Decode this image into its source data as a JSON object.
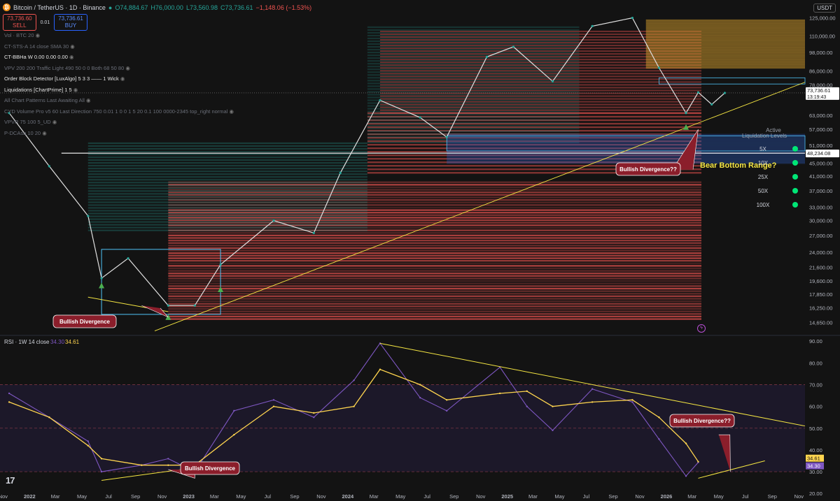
{
  "header": {
    "symbol": "Bitcoin / TetherUS · 1D · Binance",
    "open": "O74,884.67",
    "high": "H76,000.00",
    "low": "L73,560.98",
    "close": "C73,736.61",
    "change": "−1,148.06 (−1.53%)"
  },
  "trade": {
    "sell_price": "73,736.60",
    "sell_label": "SELL",
    "qty": "0.01",
    "buy_price": "73,736.61",
    "buy_label": "BUY"
  },
  "currency": "USDT",
  "indicators": [
    {
      "text": "Vol · BTC 20",
      "bright": false
    },
    {
      "text": "CT-STS-A 14 close SMA 30",
      "bright": false
    },
    {
      "text": "CT-BBHa W 0.00 0.00 0.00",
      "bright": true
    },
    {
      "text": "VPV 200 200 Traffic Light 490 50 0 0 Both 68 50 80",
      "bright": false
    },
    {
      "text": "Order Block Detector [LuxAlgo] 5 3 3 —— 1 Wick",
      "bright": true
    },
    {
      "text": "Liquidations [ChartPrime] 1 5",
      "bright": true
    },
    {
      "text": "All Chart Patterns Last Awaiting All",
      "bright": false
    },
    {
      "text": "CYD Volume Pro v5 60 Last Direction 750 0.01 1 0 0 1 5 20 0.1 100 0000-2345 top_right normal",
      "bright": false
    },
    {
      "text": "VPVR 75 100 5_UD",
      "bright": false
    },
    {
      "text": "P-DCAsa 10 20",
      "bright": false
    }
  ],
  "chart_data": [
    {
      "type": "line",
      "title": "Bitcoin / TetherUS · 1D · Binance",
      "yscale": "log",
      "ylim": [
        13500,
        135000
      ],
      "y_ticks": [
        "125,000.00",
        "110,000.00",
        "98,000.00",
        "86,000.00",
        "78,000.00",
        "63,000.00",
        "57,000.00",
        "51,000.00",
        "45,000.00",
        "41,000.00",
        "37,000.00",
        "33,000.00",
        "30,000.00",
        "27,000.00",
        "24,000.00",
        "21,600.00",
        "19,600.00",
        "17,850.00",
        "16,250.00",
        "14,650.00"
      ],
      "x_ticks": [
        "Nov",
        "2022",
        "Mar",
        "May",
        "Jul",
        "Sep",
        "Nov",
        "2023",
        "Mar",
        "May",
        "Jul",
        "Sep",
        "Nov",
        "2024",
        "Mar",
        "May",
        "Jul",
        "Sep",
        "Nov",
        "2025",
        "Mar",
        "May",
        "Jul",
        "Sep",
        "Nov",
        "2026",
        "Mar",
        "May",
        "Jul",
        "Sep",
        "Nov"
      ],
      "x": [
        "2021-11",
        "2022-02",
        "2022-05",
        "2022-06",
        "2022-08",
        "2022-11",
        "2023-01",
        "2023-03",
        "2023-07",
        "2023-10",
        "2023-12",
        "2024-03",
        "2024-06",
        "2024-08",
        "2024-11",
        "2025-01",
        "2025-04",
        "2025-07",
        "2025-10",
        "2025-12",
        "2026-02",
        "2026-03",
        "2026-04",
        "2026-05"
      ],
      "series": [
        {
          "values": [
            64000,
            44000,
            31000,
            20000,
            23000,
            16500,
            16500,
            22000,
            30000,
            27500,
            42000,
            70000,
            62000,
            54000,
            95000,
            102000,
            80000,
            118000,
            125000,
            88000,
            64000,
            74000,
            68000,
            73700
          ]
        }
      ],
      "price_labels": {
        "current": "73,736.61",
        "countdown": "13:19:43",
        "marked": "48,234.08"
      },
      "annotations": [
        {
          "text": "Bullish Divergence",
          "x": "2022-10"
        },
        {
          "text": "Bullish Divergence??",
          "x": "2026-02"
        },
        {
          "text": "Bear Bottom Range?",
          "x": "2026-05"
        }
      ],
      "liquidation_panel": {
        "title": "Active Liquidation Levels",
        "levels": [
          "5X",
          "10X",
          "25X",
          "50X",
          "100X"
        ],
        "color": "#00e676"
      }
    },
    {
      "type": "line",
      "title": "RSI · 1W 14 close",
      "values_label": [
        "34.30",
        "34.61"
      ],
      "ylim": [
        22,
        92
      ],
      "y_ticks": [
        "90.00",
        "80.00",
        "70.00",
        "60.00",
        "50.00",
        "40.00",
        "30.00",
        "20.00"
      ],
      "levels": [
        70,
        50,
        30
      ],
      "x": [
        "2021-11",
        "2022-02",
        "2022-05",
        "2022-06",
        "2022-09",
        "2022-11",
        "2023-01",
        "2023-04",
        "2023-07",
        "2023-10",
        "2024-01",
        "2024-03",
        "2024-06",
        "2024-08",
        "2024-12",
        "2025-02",
        "2025-04",
        "2025-07",
        "2025-10",
        "2025-12",
        "2026-02",
        "2026-03"
      ],
      "series": [
        {
          "name": "RSI",
          "color": "#7e57c2",
          "values": [
            66,
            55,
            44,
            30,
            33,
            36,
            30,
            58,
            63,
            55,
            72,
            89,
            64,
            58,
            78,
            60,
            49,
            68,
            62,
            45,
            28,
            34.3
          ]
        },
        {
          "name": "MA",
          "color": "#ffd54f",
          "values": [
            62,
            55,
            42,
            36,
            33,
            33,
            33,
            47,
            60,
            57,
            60,
            77,
            70,
            63,
            66,
            67,
            60,
            62,
            63,
            55,
            43,
            34.61
          ]
        }
      ],
      "annotations": [
        {
          "text": "Bullish Divergence",
          "x": "2022-11"
        },
        {
          "text": "Bullish Divergence??",
          "x": "2026-04"
        }
      ]
    }
  ],
  "colors": {
    "bg": "#131313",
    "green": "#26a69a",
    "red": "#ef5350",
    "yellow": "#f5e642",
    "purple": "#7e57c2",
    "gold": "#ffd54f",
    "cyan": "#4fc3f7"
  }
}
